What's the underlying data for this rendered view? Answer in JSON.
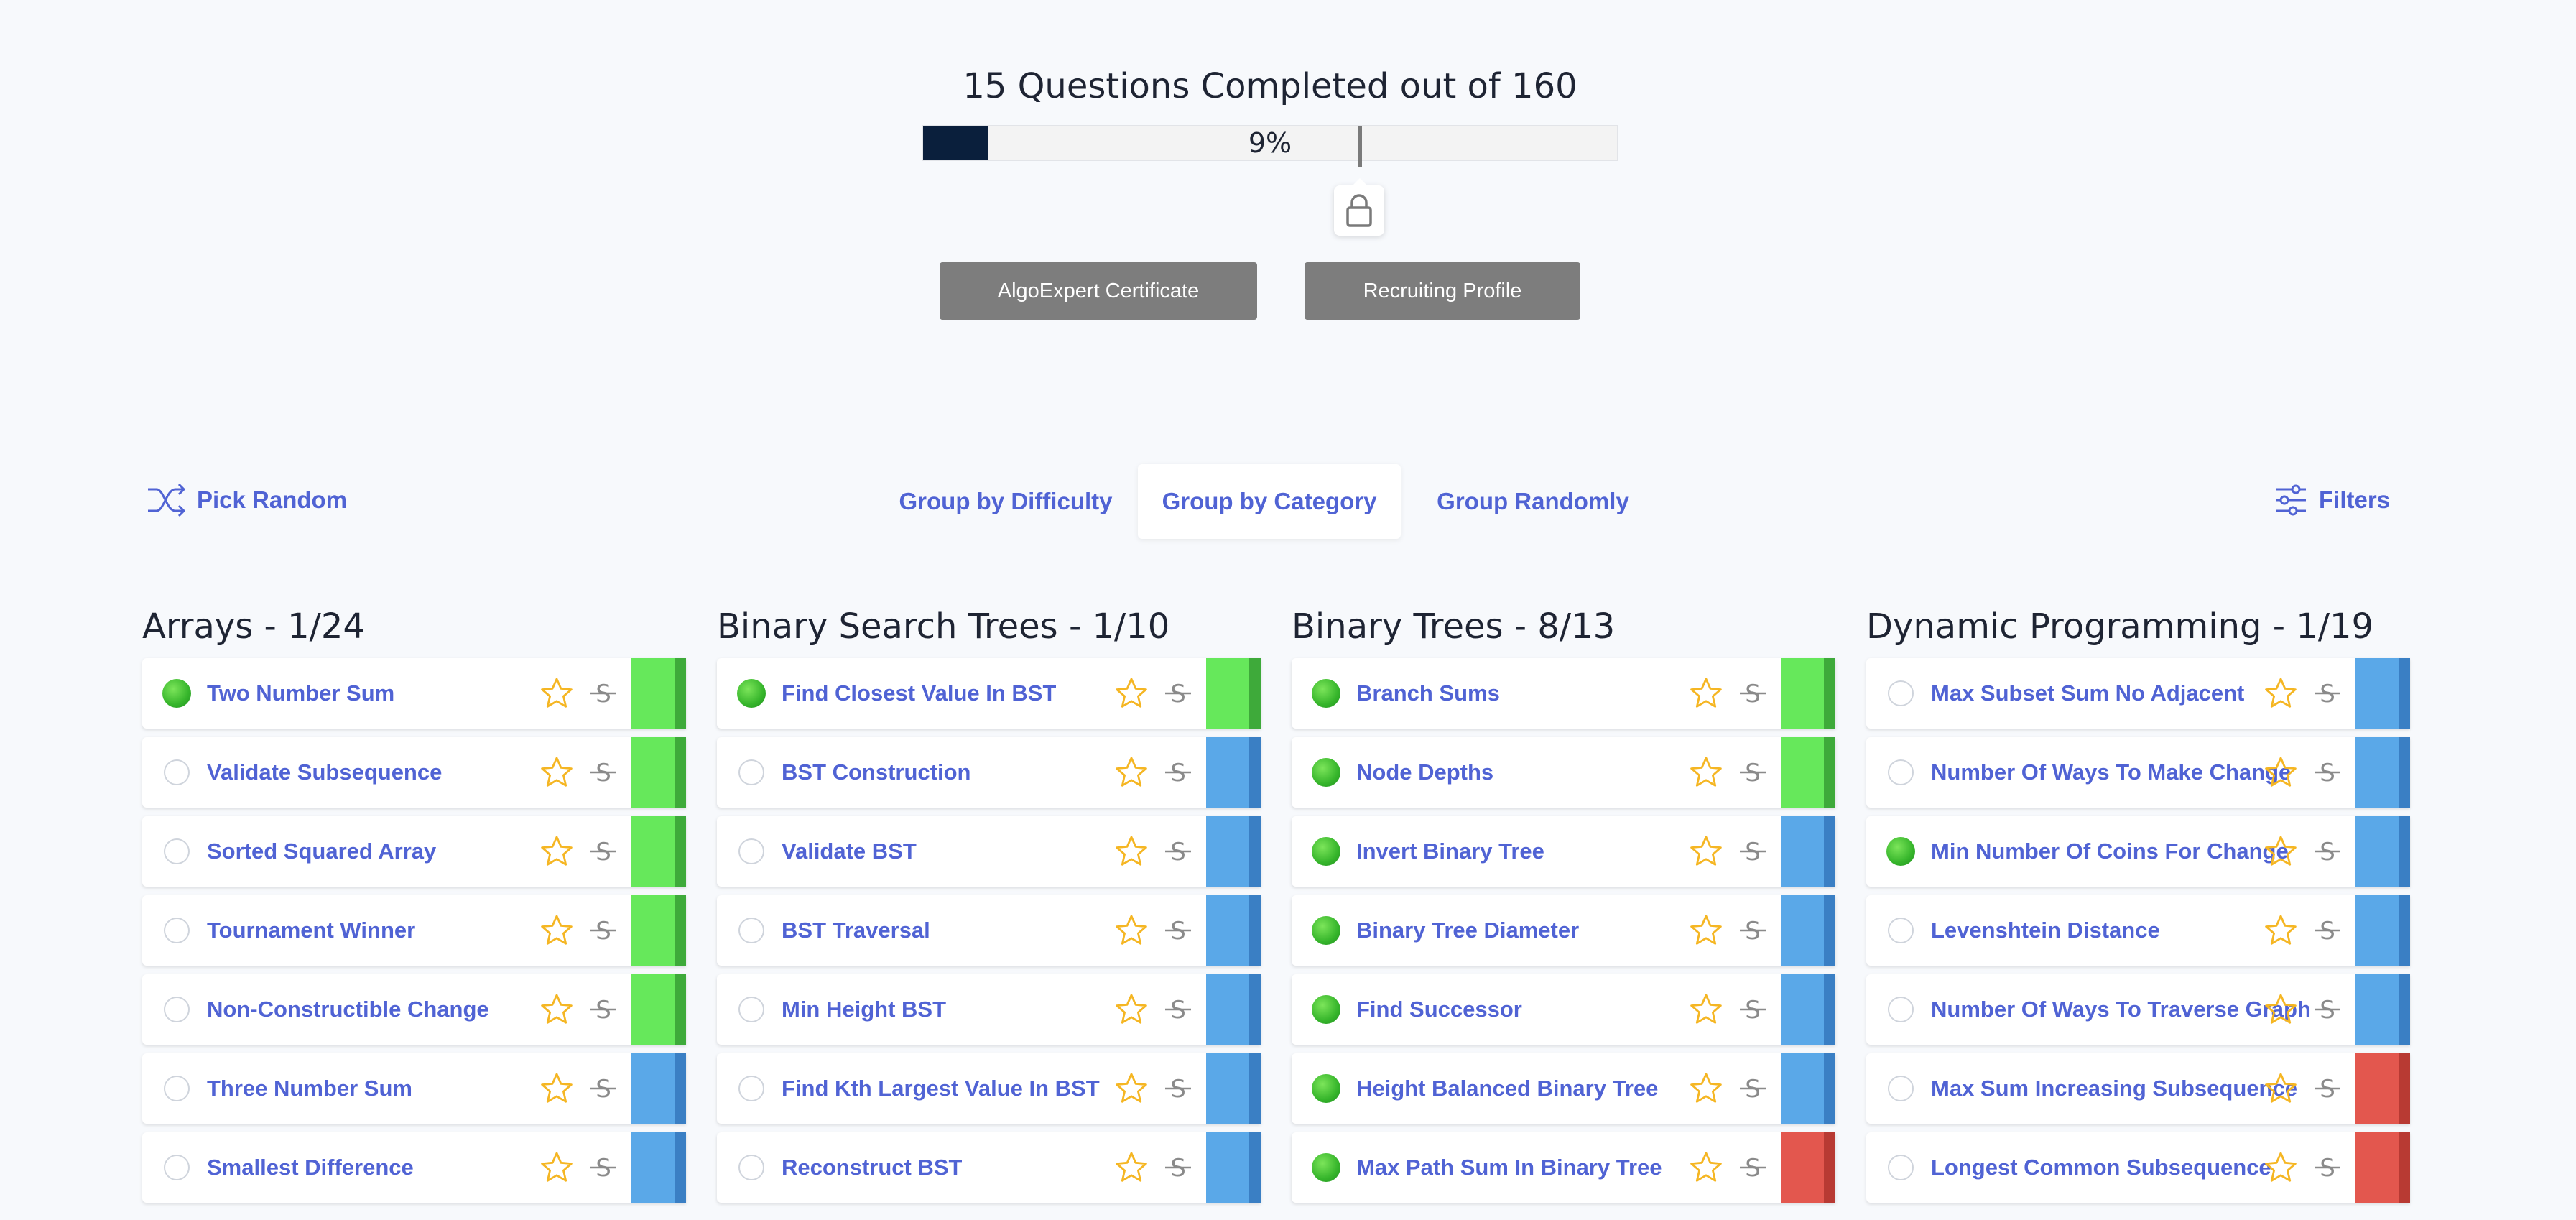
{
  "progress": {
    "title": "15 Questions Completed out of 160",
    "percent_label": "9%",
    "completed": 15,
    "total": 160,
    "fraction": 0.094
  },
  "buttons": {
    "certificate": "AlgoExpert Certificate",
    "recruiting": "Recruiting Profile"
  },
  "toolbar": {
    "pick_random": "Pick Random",
    "filters": "Filters",
    "tabs": [
      {
        "label": "Group by Difficulty",
        "active": false
      },
      {
        "label": "Group by Category",
        "active": true
      },
      {
        "label": "Group Randomly",
        "active": false
      }
    ]
  },
  "colors": {
    "accent": "#5063d4",
    "easy": "#66e85b",
    "easy_edge": "#3eaa3a",
    "medium": "#5aa8e8",
    "medium_edge": "#3a7fc4",
    "hard": "#e3574e",
    "hard_edge": "#b83a33",
    "progress_fill": "#0a1f3c",
    "star": "#f5b623"
  },
  "icons": {
    "lock": "lock-icon",
    "shuffle": "shuffle-icon",
    "filters": "sliders-icon",
    "star": "star-icon",
    "strike": "strikethrough-icon"
  },
  "columns": [
    {
      "title": "Arrays - 1/24",
      "questions": [
        {
          "name": "Two Number Sum",
          "done": true,
          "difficulty": "easy"
        },
        {
          "name": "Validate Subsequence",
          "done": false,
          "difficulty": "easy"
        },
        {
          "name": "Sorted Squared Array",
          "done": false,
          "difficulty": "easy"
        },
        {
          "name": "Tournament Winner",
          "done": false,
          "difficulty": "easy"
        },
        {
          "name": "Non-Constructible Change",
          "done": false,
          "difficulty": "easy"
        },
        {
          "name": "Three Number Sum",
          "done": false,
          "difficulty": "medium"
        },
        {
          "name": "Smallest Difference",
          "done": false,
          "difficulty": "medium"
        }
      ]
    },
    {
      "title": "Binary Search Trees - 1/10",
      "questions": [
        {
          "name": "Find Closest Value In BST",
          "done": true,
          "difficulty": "easy"
        },
        {
          "name": "BST Construction",
          "done": false,
          "difficulty": "medium"
        },
        {
          "name": "Validate BST",
          "done": false,
          "difficulty": "medium"
        },
        {
          "name": "BST Traversal",
          "done": false,
          "difficulty": "medium"
        },
        {
          "name": "Min Height BST",
          "done": false,
          "difficulty": "medium"
        },
        {
          "name": "Find Kth Largest Value In BST",
          "done": false,
          "difficulty": "medium"
        },
        {
          "name": "Reconstruct BST",
          "done": false,
          "difficulty": "medium"
        }
      ]
    },
    {
      "title": "Binary Trees - 8/13",
      "questions": [
        {
          "name": "Branch Sums",
          "done": true,
          "difficulty": "easy"
        },
        {
          "name": "Node Depths",
          "done": true,
          "difficulty": "easy"
        },
        {
          "name": "Invert Binary Tree",
          "done": true,
          "difficulty": "medium"
        },
        {
          "name": "Binary Tree Diameter",
          "done": true,
          "difficulty": "medium"
        },
        {
          "name": "Find Successor",
          "done": true,
          "difficulty": "medium"
        },
        {
          "name": "Height Balanced Binary Tree",
          "done": true,
          "difficulty": "medium"
        },
        {
          "name": "Max Path Sum In Binary Tree",
          "done": true,
          "difficulty": "hard"
        }
      ]
    },
    {
      "title": "Dynamic Programming - 1/19",
      "questions": [
        {
          "name": "Max Subset Sum No Adjacent",
          "done": false,
          "difficulty": "medium"
        },
        {
          "name": "Number Of Ways To Make Change",
          "done": false,
          "difficulty": "medium"
        },
        {
          "name": "Min Number Of Coins For Change",
          "done": true,
          "difficulty": "medium"
        },
        {
          "name": "Levenshtein Distance",
          "done": false,
          "difficulty": "medium"
        },
        {
          "name": "Number Of Ways To Traverse Graph",
          "done": false,
          "difficulty": "medium"
        },
        {
          "name": "Max Sum Increasing Subsequence",
          "done": false,
          "difficulty": "hard"
        },
        {
          "name": "Longest Common Subsequence",
          "done": false,
          "difficulty": "hard"
        }
      ]
    }
  ]
}
